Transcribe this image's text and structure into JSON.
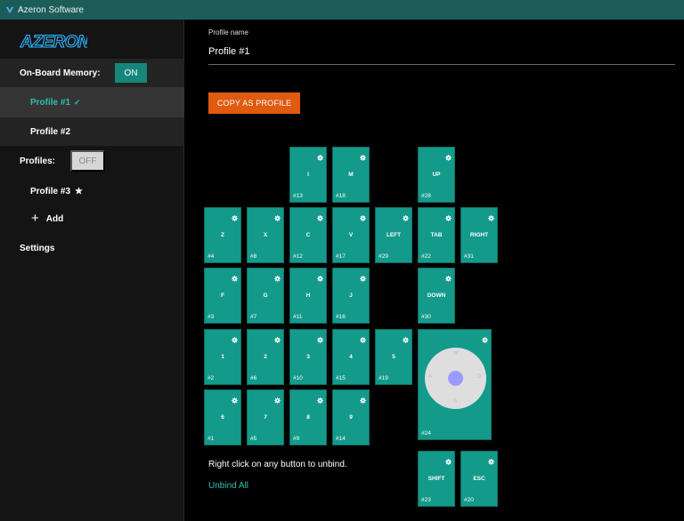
{
  "window": {
    "title": "Azeron Software"
  },
  "brand": {
    "logo_text": "AZERON",
    "accent": "#15877a",
    "orange": "#e05a0f"
  },
  "sidebar": {
    "onboard_label": "On-Board Memory:",
    "onboard_state": "ON",
    "onboard_profiles": [
      {
        "label": "Profile #1",
        "active": true,
        "check": "✓"
      },
      {
        "label": "Profile #2",
        "active": false
      }
    ],
    "profiles_label": "Profiles:",
    "profiles_state": "OFF",
    "profile3": {
      "label": "Profile #3",
      "star": "★"
    },
    "add_label": "Add",
    "settings_label": "Settings"
  },
  "main": {
    "profile_name_label": "Profile name",
    "profile_name_value": "Profile #1",
    "copy_button": "COPY AS PROFILE",
    "hint": "Right click on any button to unbind.",
    "unbind_all": "Unbind All"
  },
  "keys": [
    {
      "label": "I",
      "num": "#13"
    },
    {
      "label": "M",
      "num": "#18"
    },
    {
      "label": "UP",
      "num": "#28"
    },
    {
      "label": "Z",
      "num": "#4"
    },
    {
      "label": "X",
      "num": "#8"
    },
    {
      "label": "C",
      "num": "#12"
    },
    {
      "label": "V",
      "num": "#17"
    },
    {
      "label": "LEFT",
      "num": "#29"
    },
    {
      "label": "TAB",
      "num": "#22"
    },
    {
      "label": "RIGHT",
      "num": "#31"
    },
    {
      "label": "F",
      "num": "#3"
    },
    {
      "label": "G",
      "num": "#7"
    },
    {
      "label": "H",
      "num": "#11"
    },
    {
      "label": "J",
      "num": "#16"
    },
    {
      "label": "DOWN",
      "num": "#30"
    },
    {
      "label": "1",
      "num": "#2"
    },
    {
      "label": "2",
      "num": "#6"
    },
    {
      "label": "3",
      "num": "#10"
    },
    {
      "label": "4",
      "num": "#15"
    },
    {
      "label": "5",
      "num": "#19"
    },
    {
      "label": "6",
      "num": "#1"
    },
    {
      "label": "7",
      "num": "#5"
    },
    {
      "label": "8",
      "num": "#9"
    },
    {
      "label": "9",
      "num": "#14"
    },
    {
      "label": "SHIFT",
      "num": "#23"
    },
    {
      "label": "ESC",
      "num": "#20"
    }
  ],
  "joystick": {
    "num": "#24",
    "w": "W",
    "a": "A",
    "s": "S",
    "d": "D"
  }
}
